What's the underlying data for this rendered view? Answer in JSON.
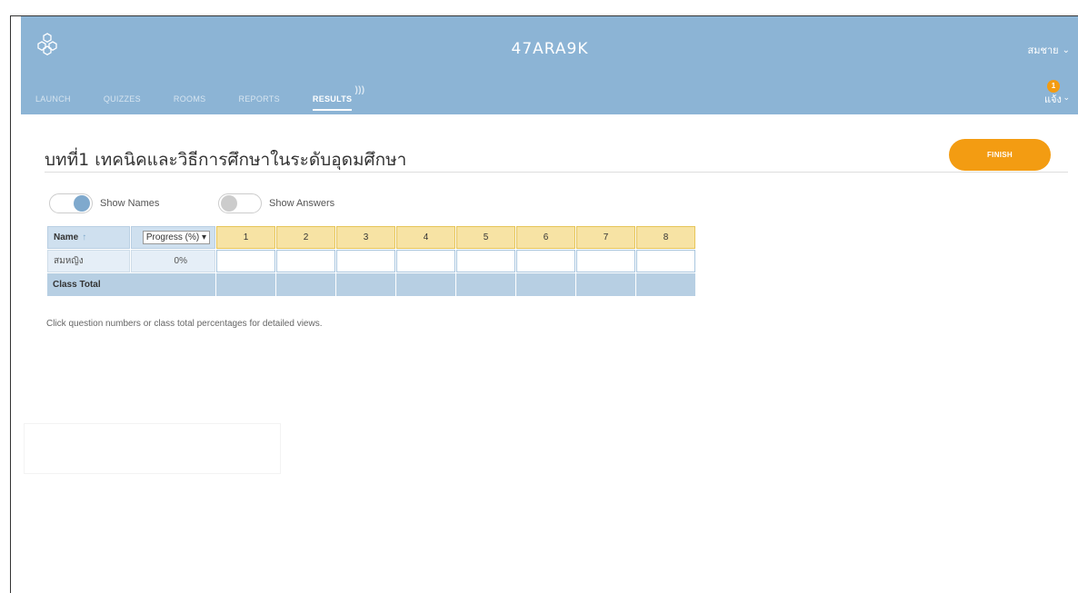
{
  "header": {
    "room_code": "47ARA9K",
    "user_name": "สมชาย",
    "notifications_count": "1",
    "notification_label": "แจ้ง",
    "brand_color": "#8cb4d5"
  },
  "nav": {
    "items": [
      "LAUNCH",
      "QUIZZES",
      "ROOMS",
      "REPORTS",
      "RESULTS"
    ],
    "active": "RESULTS"
  },
  "quiz": {
    "title": "บทที่1 เทคนิคและวิธีการศึกษาในระดับอุดมศึกษา",
    "finish_label": "FINISH",
    "finish_color": "#f39c12"
  },
  "toggles": {
    "show_names": {
      "label": "Show Names",
      "on": true
    },
    "show_answers": {
      "label": "Show Answers",
      "on": false
    }
  },
  "table": {
    "name_header": "Name",
    "sort_icon": "arrow-up-icon",
    "progress_header": "Progress (%)",
    "questions": [
      "1",
      "2",
      "3",
      "4",
      "5",
      "6",
      "7",
      "8"
    ],
    "students": [
      {
        "name": "สมหญิง",
        "progress": "0%"
      }
    ],
    "class_total_label": "Class Total"
  },
  "hint": "Click question numbers or class total percentages for detailed views."
}
